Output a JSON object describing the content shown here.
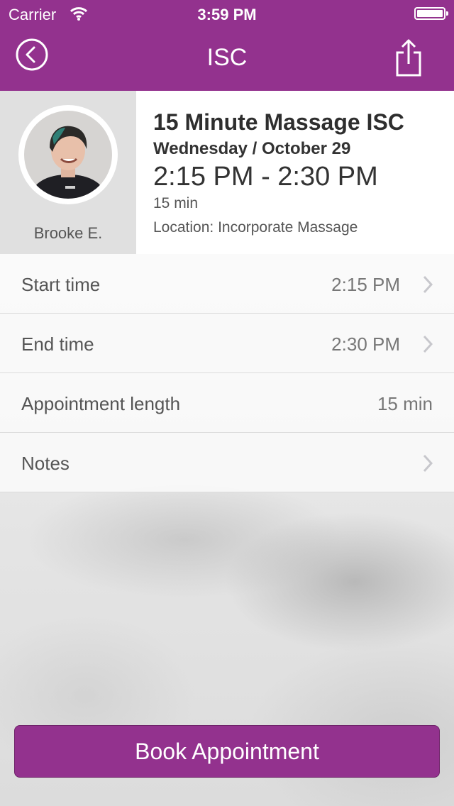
{
  "status_bar": {
    "carrier": "Carrier",
    "time": "3:59 PM"
  },
  "nav": {
    "title": "ISC"
  },
  "staff": {
    "name": "Brooke E."
  },
  "class": {
    "title": "15 Minute Massage ISC",
    "date": "Wednesday / October 29",
    "time_range": "2:15 PM - 2:30 PM",
    "duration": "15 min",
    "location": "Location: Incorporate Massage"
  },
  "rows": [
    {
      "label": "Start time",
      "value": "2:15 PM"
    },
    {
      "label": "End time",
      "value": "2:30 PM"
    },
    {
      "label": "Appointment length",
      "value": "15 min"
    },
    {
      "label": "Notes",
      "value": ""
    }
  ],
  "book_button": {
    "label": "Book Appointment"
  },
  "colors": {
    "brand": "#93328e",
    "background": "#e9e9e9"
  }
}
